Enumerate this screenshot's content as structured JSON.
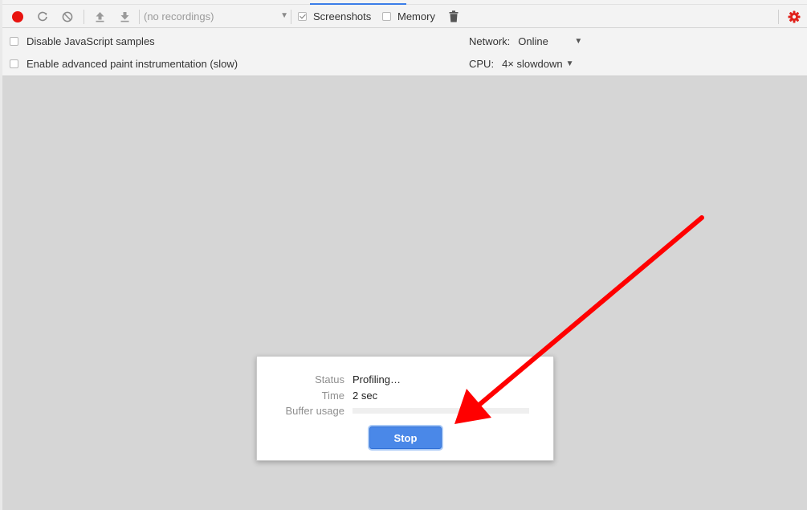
{
  "toolbar": {
    "recordings_placeholder": "(no recordings)",
    "screenshots_label": "Screenshots",
    "screenshots_checked": true,
    "memory_label": "Memory",
    "memory_checked": false,
    "icons": [
      "record-icon",
      "reload-icon",
      "clear-icon",
      "upload-icon",
      "download-icon",
      "trash-icon",
      "gear-icon"
    ]
  },
  "settings": {
    "disable_js_samples": "Disable JavaScript samples",
    "advanced_paint": "Enable advanced paint instrumentation (slow)",
    "network_label": "Network:",
    "network_value": "Online",
    "cpu_label": "CPU:",
    "cpu_value": "4× slowdown"
  },
  "status_dialog": {
    "status_label": "Status",
    "status_value": "Profiling…",
    "time_label": "Time",
    "time_value": "2 sec",
    "buffer_label": "Buffer usage",
    "buffer_usage": 0,
    "stop_label": "Stop"
  },
  "colors": {
    "record": "#e8130f",
    "accent": "#3b7de8",
    "annotation_arrow": "#ff0000",
    "gear": "#e0201a"
  }
}
